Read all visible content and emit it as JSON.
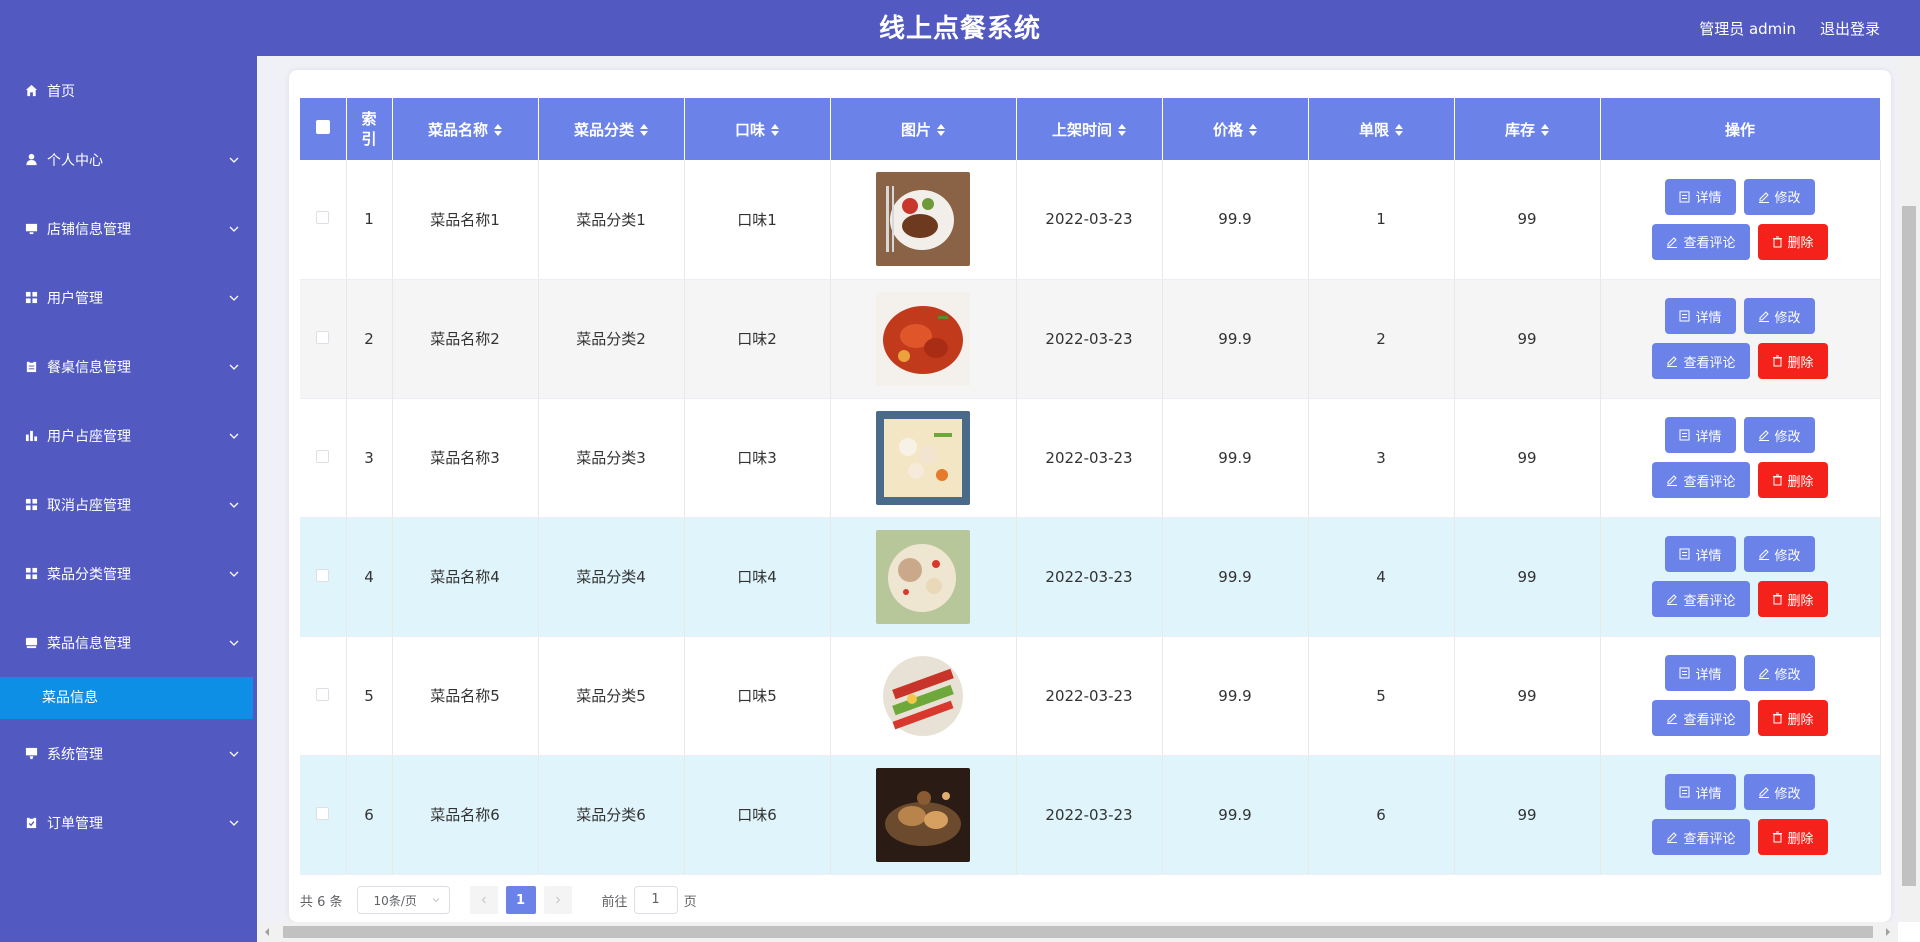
{
  "header": {
    "title": "线上点餐系统",
    "user_label": "管理员 admin",
    "logout_label": "退出登录"
  },
  "sidebar": {
    "items": [
      {
        "label": "首页",
        "icon": "home-icon"
      },
      {
        "label": "个人中心",
        "icon": "user-icon"
      },
      {
        "label": "店铺信息管理",
        "icon": "monitor-icon"
      },
      {
        "label": "用户管理",
        "icon": "grid-icon"
      },
      {
        "label": "餐桌信息管理",
        "icon": "clipboard-icon"
      },
      {
        "label": "用户占座管理",
        "icon": "bar-chart-icon"
      },
      {
        "label": "取消占座管理",
        "icon": "grid-icon"
      },
      {
        "label": "菜品分类管理",
        "icon": "grid-icon"
      },
      {
        "label": "菜品信息管理",
        "icon": "tray-icon"
      },
      {
        "label": "系统管理",
        "icon": "display-icon"
      },
      {
        "label": "订单管理",
        "icon": "clipboard-check-icon"
      }
    ],
    "active_submenu": "菜品信息"
  },
  "table": {
    "columns": [
      "索引",
      "菜品名称",
      "菜品分类",
      "口味",
      "图片",
      "上架时间",
      "价格",
      "单限",
      "库存",
      "操作"
    ],
    "rows": [
      {
        "index": "1",
        "name": "菜品名称1",
        "category": "菜品分类1",
        "flavor": "口味1",
        "date": "2022-03-23",
        "price": "99.9",
        "limit": "1",
        "stock": "99"
      },
      {
        "index": "2",
        "name": "菜品名称2",
        "category": "菜品分类2",
        "flavor": "口味2",
        "date": "2022-03-23",
        "price": "99.9",
        "limit": "2",
        "stock": "99"
      },
      {
        "index": "3",
        "name": "菜品名称3",
        "category": "菜品分类3",
        "flavor": "口味3",
        "date": "2022-03-23",
        "price": "99.9",
        "limit": "3",
        "stock": "99"
      },
      {
        "index": "4",
        "name": "菜品名称4",
        "category": "菜品分类4",
        "flavor": "口味4",
        "date": "2022-03-23",
        "price": "99.9",
        "limit": "4",
        "stock": "99"
      },
      {
        "index": "5",
        "name": "菜品名称5",
        "category": "菜品分类5",
        "flavor": "口味5",
        "date": "2022-03-23",
        "price": "99.9",
        "limit": "5",
        "stock": "99"
      },
      {
        "index": "6",
        "name": "菜品名称6",
        "category": "菜品分类6",
        "flavor": "口味6",
        "date": "2022-03-23",
        "price": "99.9",
        "limit": "6",
        "stock": "99"
      }
    ],
    "actions": {
      "detail": "详情",
      "edit": "修改",
      "comments": "查看评论",
      "delete": "删除"
    }
  },
  "pagination": {
    "total_text": "共 6 条",
    "page_size": "10条/页",
    "current_page": "1",
    "goto_prefix": "前往",
    "goto_value": "1",
    "goto_suffix": "页"
  },
  "colors": {
    "header_bg": "#5259c1",
    "table_header": "#6b82e8",
    "danger": "#f5221b",
    "active_menu": "#0e8fe6",
    "row_highlight": "#dff4fb"
  }
}
